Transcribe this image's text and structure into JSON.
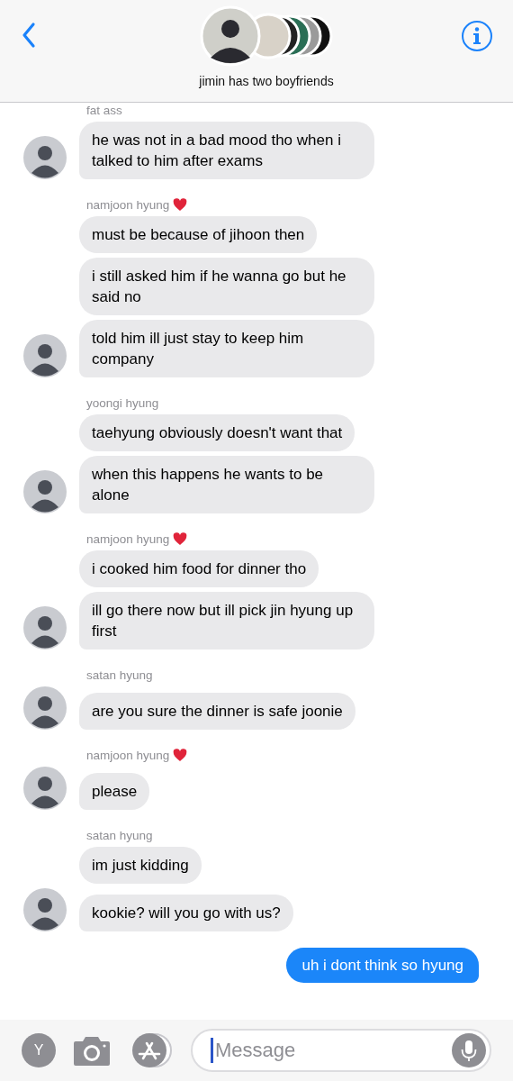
{
  "header": {
    "title": "jimin has two boyfriends"
  },
  "groups": [
    {
      "sender": "fat ass",
      "heart": false,
      "messages": [
        "he was not in a bad mood tho when i talked to him after exams"
      ]
    },
    {
      "sender": "namjoon hyung",
      "heart": true,
      "messages": [
        "must be because of jihoon then",
        "i still asked him if he wanna go but he said no",
        "told him ill just stay to keep him company"
      ]
    },
    {
      "sender": "yoongi hyung",
      "heart": false,
      "messages": [
        "taehyung obviously doesn't want that",
        "when this happens he wants to be alone"
      ]
    },
    {
      "sender": "namjoon hyung",
      "heart": true,
      "messages": [
        "i cooked him food for dinner tho",
        "ill go there now but ill pick jin hyung up first"
      ]
    },
    {
      "sender": "satan hyung",
      "heart": false,
      "messages": [
        "are you sure the dinner is safe joonie"
      ]
    },
    {
      "sender": "namjoon hyung",
      "heart": true,
      "messages": [
        "please"
      ]
    },
    {
      "sender": "satan hyung",
      "heart": false,
      "messages": [
        "im just kidding",
        "kookie? will you go with us?"
      ]
    }
  ],
  "outgoing": [
    "uh i dont think so hyung"
  ],
  "composer": {
    "initial": "Y",
    "placeholder": "Message"
  }
}
